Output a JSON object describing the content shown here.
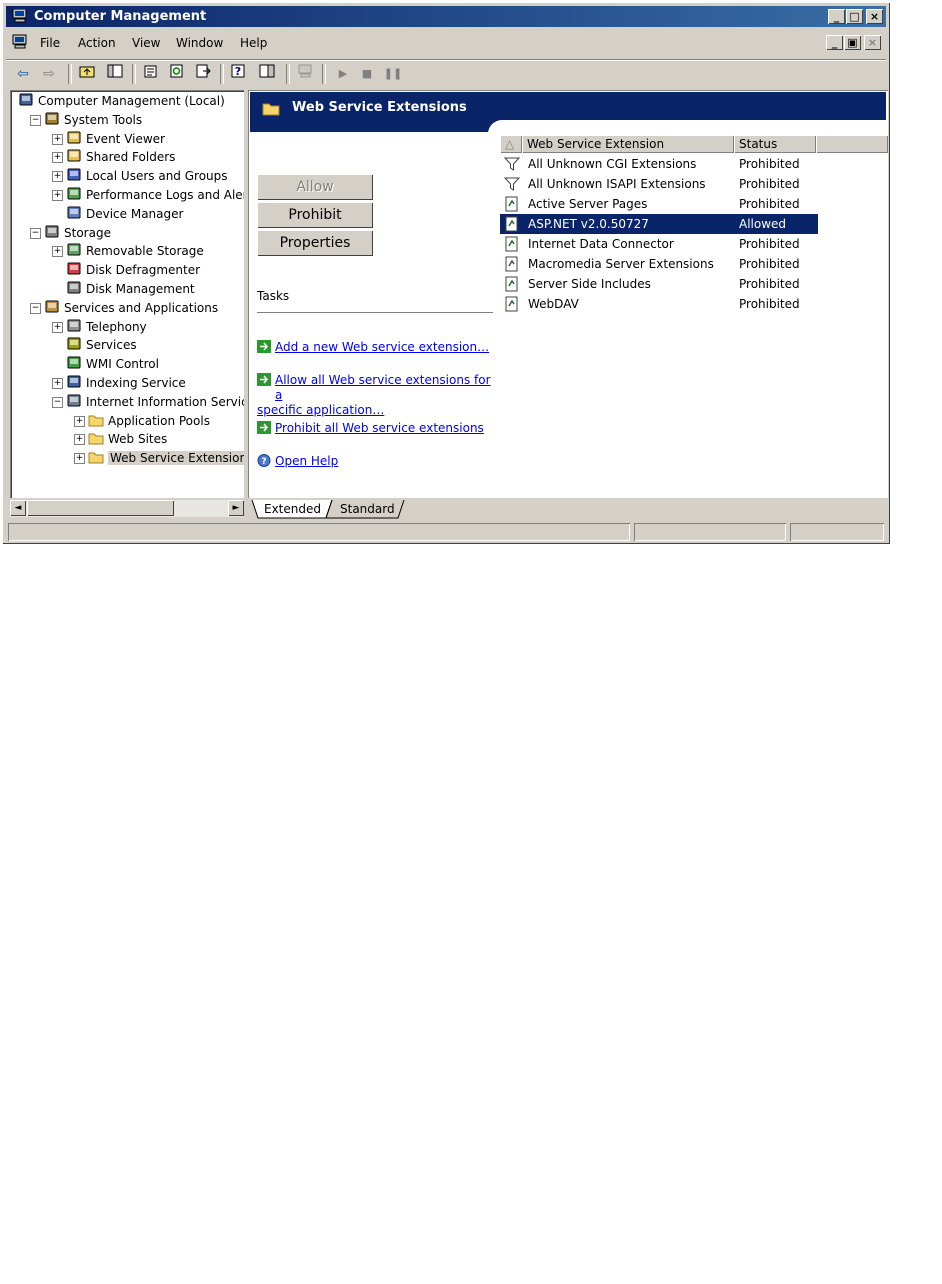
{
  "window": {
    "title": "Computer Management",
    "controls": {
      "minimize": "_",
      "maximize": "□",
      "close": "×"
    },
    "mdi_controls": {
      "minimize": "_",
      "restore": "▣",
      "close": "×"
    }
  },
  "menu": [
    "File",
    "Action",
    "View",
    "Window",
    "Help"
  ],
  "toolbar": {
    "icons": [
      "back-icon",
      "forward-icon",
      "up-folder-icon",
      "show-hide-tree-icon",
      "properties-icon",
      "refresh-icon",
      "export-list-icon",
      "help-icon",
      "show-hide-action-pane-icon",
      "connect-computer-icon",
      "start-icon",
      "stop-icon",
      "pause-icon"
    ]
  },
  "tree": [
    {
      "label": "Computer Management (Local)",
      "level": 0
    },
    {
      "label": "System Tools",
      "level": 1,
      "expander": "−"
    },
    {
      "label": "Event Viewer",
      "level": 2,
      "expander": "+"
    },
    {
      "label": "Shared Folders",
      "level": 2,
      "expander": "+"
    },
    {
      "label": "Local Users and Groups",
      "level": 2,
      "expander": "+"
    },
    {
      "label": "Performance Logs and Alerts",
      "level": 2,
      "expander": "+"
    },
    {
      "label": "Device Manager",
      "level": 2
    },
    {
      "label": "Storage",
      "level": 1,
      "expander": "−"
    },
    {
      "label": "Removable Storage",
      "level": 2,
      "expander": "+"
    },
    {
      "label": "Disk Defragmenter",
      "level": 2
    },
    {
      "label": "Disk Management",
      "level": 2
    },
    {
      "label": "Services and Applications",
      "level": 1,
      "expander": "−"
    },
    {
      "label": "Telephony",
      "level": 2,
      "expander": "+"
    },
    {
      "label": "Services",
      "level": 2
    },
    {
      "label": "WMI Control",
      "level": 2
    },
    {
      "label": "Indexing Service",
      "level": 2,
      "expander": "+"
    },
    {
      "label": "Internet Information Services",
      "level": 2,
      "expander": "−"
    },
    {
      "label": "Application Pools",
      "level": 3,
      "expander": "+"
    },
    {
      "label": "Web Sites",
      "level": 3,
      "expander": "+"
    },
    {
      "label": "Web Service Extensions",
      "level": 3,
      "expander": "+",
      "selected": true
    }
  ],
  "scroll": {
    "left": "◄",
    "right": "►"
  },
  "panel": {
    "title": "Web Service Extensions",
    "buttons": {
      "allow": "Allow",
      "prohibit": "Prohibit",
      "properties": "Properties"
    },
    "tasks_heading": "Tasks",
    "tasks": {
      "add": "Add a new Web service extension…",
      "allow_line1": "Allow all Web service extensions for a",
      "allow_line2": "specific application…",
      "prohibit": "Prohibit all Web service extensions",
      "help": "Open Help"
    }
  },
  "list": {
    "columns": {
      "sort": "△",
      "name": "Web Service Extension",
      "status": "Status"
    },
    "rows": [
      {
        "name": "All Unknown CGI Extensions",
        "status": "Prohibited",
        "icon": "filter-icon"
      },
      {
        "name": "All Unknown ISAPI Extensions",
        "status": "Prohibited",
        "icon": "filter-icon"
      },
      {
        "name": "Active Server Pages",
        "status": "Prohibited",
        "icon": "extension-icon"
      },
      {
        "name": "ASP.NET v2.0.50727",
        "status": "Allowed",
        "icon": "extension-icon",
        "selected": true
      },
      {
        "name": "Internet Data Connector",
        "status": "Prohibited",
        "icon": "extension-icon"
      },
      {
        "name": "Macromedia Server Extensions",
        "status": "Prohibited",
        "icon": "extension-icon"
      },
      {
        "name": "Server Side Includes",
        "status": "Prohibited",
        "icon": "extension-icon"
      },
      {
        "name": "WebDAV",
        "status": "Prohibited",
        "icon": "extension-icon"
      }
    ]
  },
  "tabs": {
    "extended": "Extended",
    "standard": "Standard"
  },
  "colors": {
    "titlebar": "#0a246a",
    "selection": "#0a246a",
    "link": "#0000ee",
    "face": "#d4d0c8"
  }
}
